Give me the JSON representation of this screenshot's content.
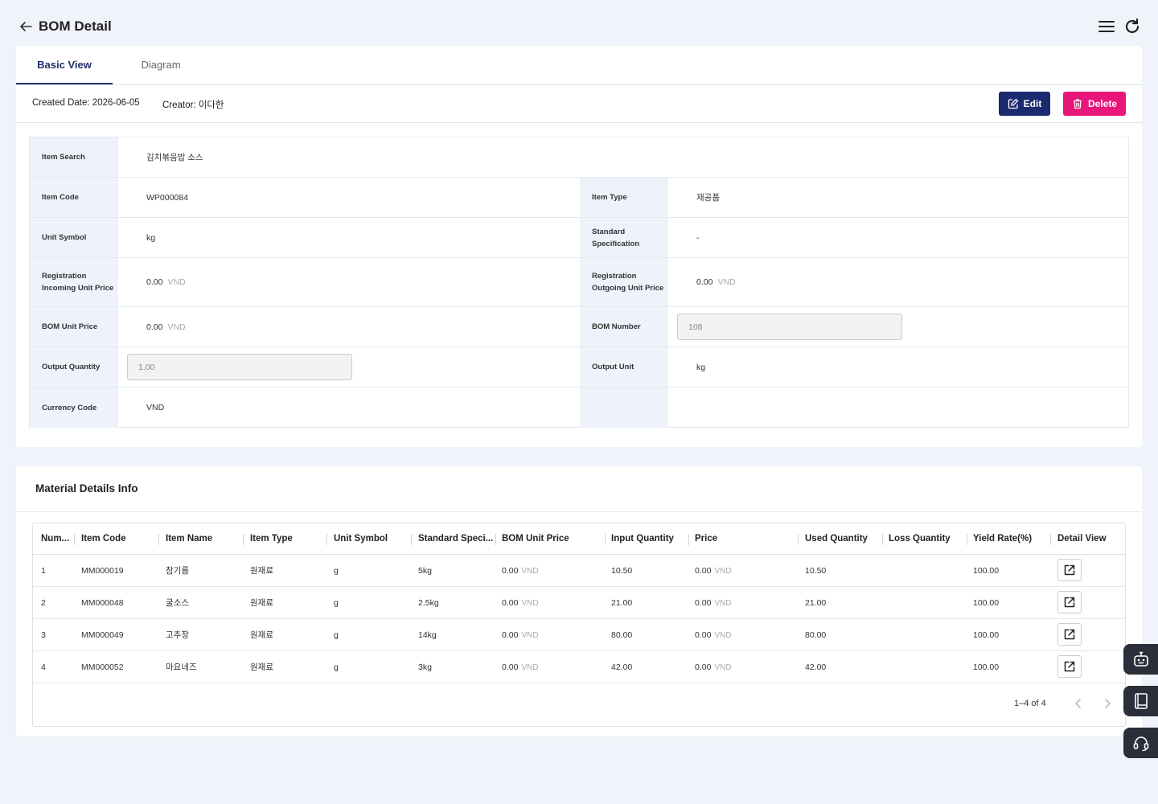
{
  "header": {
    "title": "BOM Detail",
    "back_icon": "arrow-left-icon",
    "menu_icon": "hamburger-menu-icon",
    "refresh_icon": "refresh-icon"
  },
  "tabs": [
    {
      "label": "Basic View",
      "active": true
    },
    {
      "label": "Diagram",
      "active": false
    }
  ],
  "meta": {
    "created_date": "Created Date: 2026-06-05",
    "creator": "Creator: 이다한"
  },
  "actions": {
    "edit_label": "Edit",
    "delete_label": "Delete"
  },
  "form": {
    "item_search": {
      "label": "Item Search",
      "value": "김치볶음밥 소스"
    },
    "item_code": {
      "label": "Item Code",
      "value": "WP000084"
    },
    "item_type": {
      "label": "Item Type",
      "value": "재공품"
    },
    "unit_symbol": {
      "label": "Unit Symbol",
      "value": "kg"
    },
    "standard_spec": {
      "label": "Standard Specification",
      "value": "-"
    },
    "reg_in_price": {
      "label": "Registration Incoming Unit Price",
      "value": "0.00",
      "unit": "VND"
    },
    "reg_out_price": {
      "label": "Registration Outgoing Unit Price",
      "value": "0.00",
      "unit": "VND"
    },
    "bom_unit_price": {
      "label": "BOM Unit Price",
      "value": "0.00",
      "unit": "VND"
    },
    "bom_number": {
      "label": "BOM Number",
      "value": "108"
    },
    "output_quantity": {
      "label": "Output Quantity",
      "value": "1.00"
    },
    "output_unit": {
      "label": "Output Unit",
      "value": "kg"
    },
    "currency_code": {
      "label": "Currency Code",
      "value": "VND"
    }
  },
  "materials": {
    "title": "Material Details Info",
    "columns": [
      "Num...",
      "Item Code",
      "Item Name",
      "Item Type",
      "Unit Symbol",
      "Standard Speci...",
      "BOM Unit Price",
      "Input Quantity",
      "Price",
      "Used Quantity",
      "Loss Quantity",
      "Yield Rate(%)",
      "Detail View"
    ],
    "rows": [
      {
        "num": "1",
        "code": "MM000019",
        "name": "참기름",
        "type": "원재료",
        "unit": "g",
        "spec": "5kg",
        "bom_price": "0.00",
        "input_qty": "10.50",
        "price": "0.00",
        "used_qty": "10.50",
        "loss_qty": "",
        "yield": "100.00"
      },
      {
        "num": "2",
        "code": "MM000048",
        "name": "굴소스",
        "type": "원재료",
        "unit": "g",
        "spec": "2.5kg",
        "bom_price": "0.00",
        "input_qty": "21.00",
        "price": "0.00",
        "used_qty": "21.00",
        "loss_qty": "",
        "yield": "100.00"
      },
      {
        "num": "3",
        "code": "MM000049",
        "name": "고추장",
        "type": "원재료",
        "unit": "g",
        "spec": "14kg",
        "bom_price": "0.00",
        "input_qty": "80.00",
        "price": "0.00",
        "used_qty": "80.00",
        "loss_qty": "",
        "yield": "100.00"
      },
      {
        "num": "4",
        "code": "MM000052",
        "name": "마요네즈",
        "type": "원재료",
        "unit": "g",
        "spec": "3kg",
        "bom_price": "0.00",
        "input_qty": "42.00",
        "price": "0.00",
        "used_qty": "42.00",
        "loss_qty": "",
        "yield": "100.00"
      }
    ],
    "currency_unit": "VND",
    "pagination": "1–4 of 4"
  },
  "floating": [
    "robot-assistant-icon",
    "book-icon",
    "headset-support-icon"
  ],
  "colors": {
    "primary": "#1a2a6e",
    "danger": "#e8157a",
    "label_bg": "#eef2fb",
    "page_bg": "#f1f3fa"
  }
}
